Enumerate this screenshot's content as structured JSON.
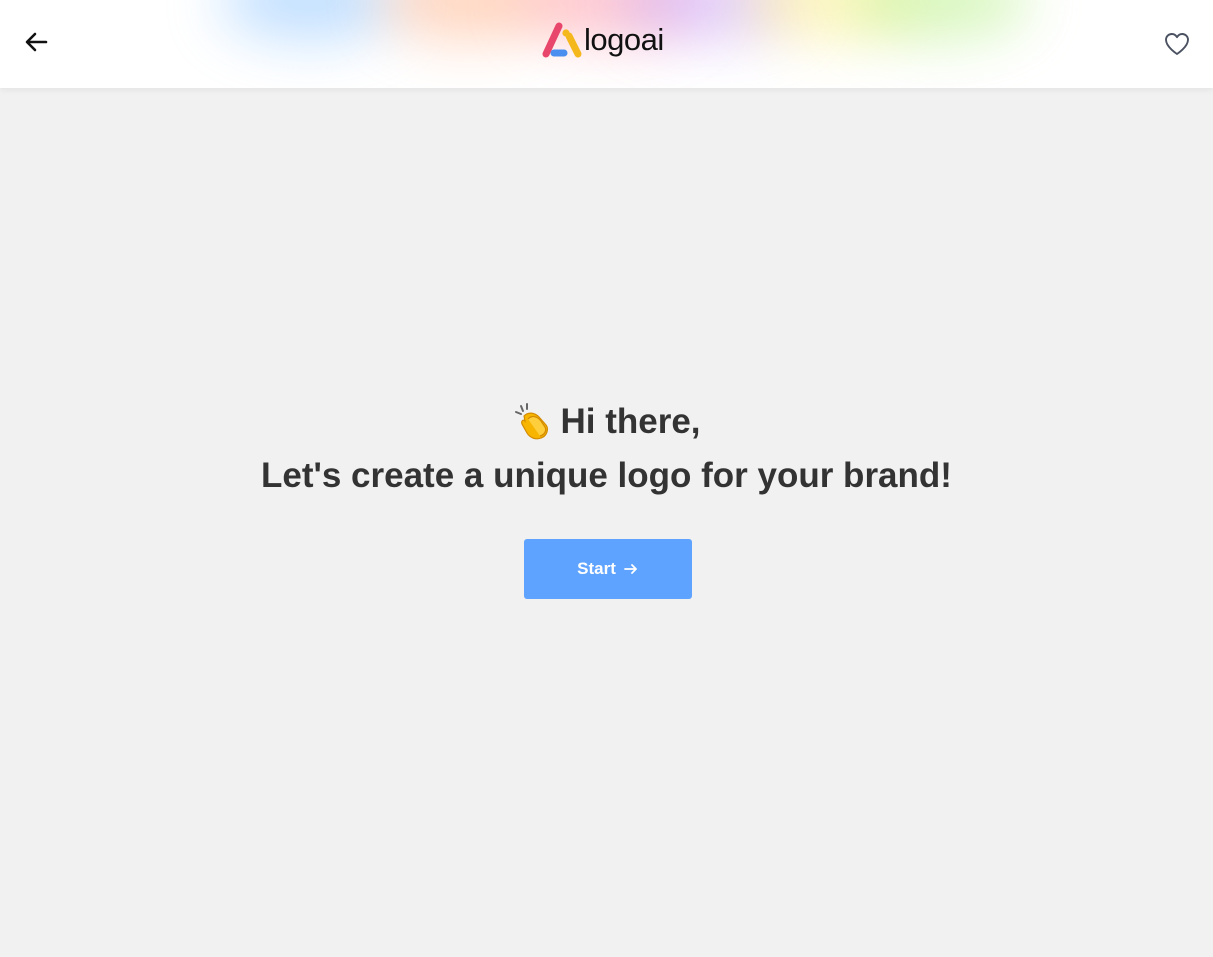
{
  "header": {
    "logo_text": "logoai",
    "back_icon": "arrow-left-icon",
    "favorite_icon": "heart-outline-icon",
    "logo_colors": {
      "red": "#e8466a",
      "yellow": "#f5b81c",
      "blue": "#4a8ff0"
    }
  },
  "hero": {
    "emoji": "👏",
    "greeting": "Hi there,",
    "headline": "Let's create a unique logo for your brand!"
  },
  "cta": {
    "label": "Start",
    "icon": "arrow-right-icon",
    "color": "#5ea3ff"
  },
  "colors": {
    "background": "#f1f1f1",
    "text": "#333333"
  }
}
